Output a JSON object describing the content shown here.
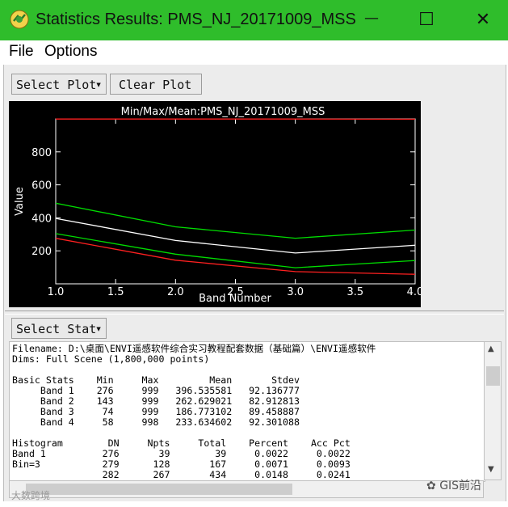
{
  "window": {
    "title": "Statistics Results: PMS_NJ_20171009_MSS",
    "minimize_glyph": "—",
    "maximize_glyph": "☐",
    "close_glyph": "✕"
  },
  "menu": {
    "items": [
      "File",
      "Options"
    ]
  },
  "toolbar": {
    "select_plot_label": "Select Plot",
    "clear_plot_label": "Clear Plot"
  },
  "stat_toolbar": {
    "select_stat_label": "Select Stat"
  },
  "chart_data": {
    "type": "line",
    "title": "Min/Max/Mean:PMS_NJ_20171009_MSS",
    "xlabel": "Band Number",
    "ylabel": "Value",
    "x": [
      1.0,
      2.0,
      3.0,
      4.0
    ],
    "xticks": [
      "1.0",
      "1.5",
      "2.0",
      "2.5",
      "3.0",
      "3.5",
      "4.0"
    ],
    "xlim": [
      1.0,
      4.0
    ],
    "yticks": [
      "200",
      "400",
      "600",
      "800"
    ],
    "ylim": [
      0,
      1000
    ],
    "background": "#000000",
    "series": [
      {
        "role": "max",
        "values": [
          999,
          999,
          999,
          998
        ],
        "color": "#ff2020"
      },
      {
        "role": "mean+stdev",
        "values": [
          488.67,
          345.54,
          276.23,
          325.94
        ],
        "color": "#00dd00"
      },
      {
        "role": "mean",
        "values": [
          396.54,
          262.63,
          186.77,
          233.63
        ],
        "color": "#ffffff"
      },
      {
        "role": "mean-stdev",
        "values": [
          304.4,
          179.72,
          97.31,
          141.33
        ],
        "color": "#00dd00"
      },
      {
        "role": "min",
        "values": [
          276,
          143,
          74,
          58
        ],
        "color": "#ff2020"
      }
    ]
  },
  "stats_text": {
    "lines": [
      "Filename: D:\\桌面\\ENVI遥感软件综合实习教程配套数据（基础篇）\\ENVI遥感软件",
      "Dims: Full Scene (1,800,000 points)",
      "",
      "Basic Stats    Min     Max         Mean       Stdev",
      "     Band 1    276     999   396.535581   92.136777",
      "     Band 2    143     999   262.629021   82.912813",
      "     Band 3     74     999   186.773102   89.458887",
      "     Band 4     58     998   233.634602   92.301088",
      "",
      "Histogram        DN     Npts     Total    Percent    Acc Pct",
      "Band 1          276       39        39     0.0022     0.0022",
      "Bin=3           279      128       167     0.0071     0.0093",
      "                282      267       434     0.0148     0.0241"
    ]
  },
  "watermark": {
    "left_text": "大数跨境",
    "right_text": "GIS前沿"
  }
}
